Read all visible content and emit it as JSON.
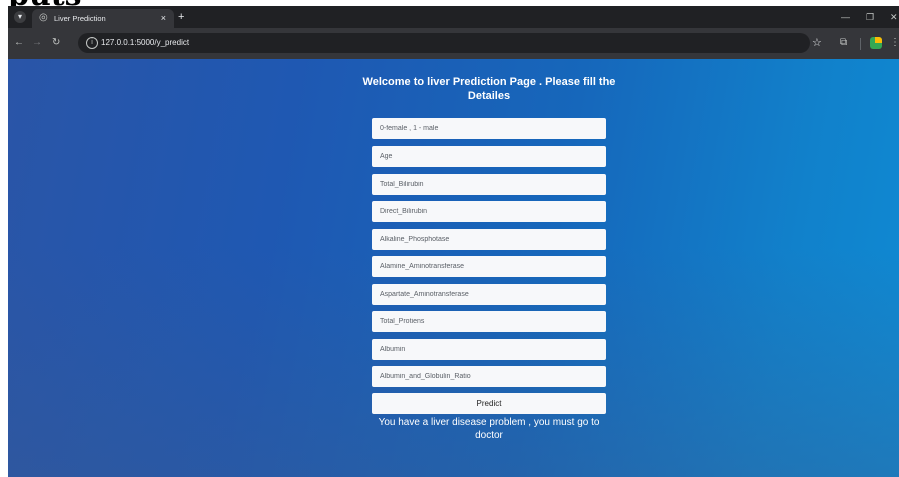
{
  "top_artifact": "puts",
  "browser": {
    "tab_title": "Liver Prediction",
    "tab_close": "×",
    "new_tab": "+",
    "url": "127.0.0.1:5000/y_predict",
    "icons": [
      "tab-menu-icon",
      "globe-icon",
      "close-icon",
      "plus-icon",
      "minimize-icon",
      "restore-icon",
      "window-close-icon",
      "back-arrow-icon",
      "forward-arrow-icon",
      "reload-icon",
      "info-icon",
      "star-icon",
      "extensions-icon",
      "profile-icon",
      "kebab-menu-icon"
    ]
  },
  "page": {
    "heading": "Welcome to liver Prediction Page . Please fill the Detailes",
    "fields": [
      {
        "placeholder": "0-female , 1 - male"
      },
      {
        "placeholder": "Age"
      },
      {
        "placeholder": "Total_Bilirubin"
      },
      {
        "placeholder": "Direct_Bilirubin"
      },
      {
        "placeholder": "Alkaline_Phosphotase"
      },
      {
        "placeholder": "Alamine_Aminotransferase"
      },
      {
        "placeholder": "Aspartate_Aminotransferase"
      },
      {
        "placeholder": "Total_Protiens"
      },
      {
        "placeholder": "Albumin"
      },
      {
        "placeholder": "Albumin_and_Globulin_Ratio"
      }
    ],
    "predict_label": "Predict",
    "result_text": "You have a liver disease problem , you must go to doctor"
  },
  "colors": {
    "browser_frame": "#202124",
    "toolbar": "#35363a",
    "gradient_start": "#2a55a7",
    "gradient_end": "#0f8ad3",
    "field_bg": "#f7f8fa"
  }
}
